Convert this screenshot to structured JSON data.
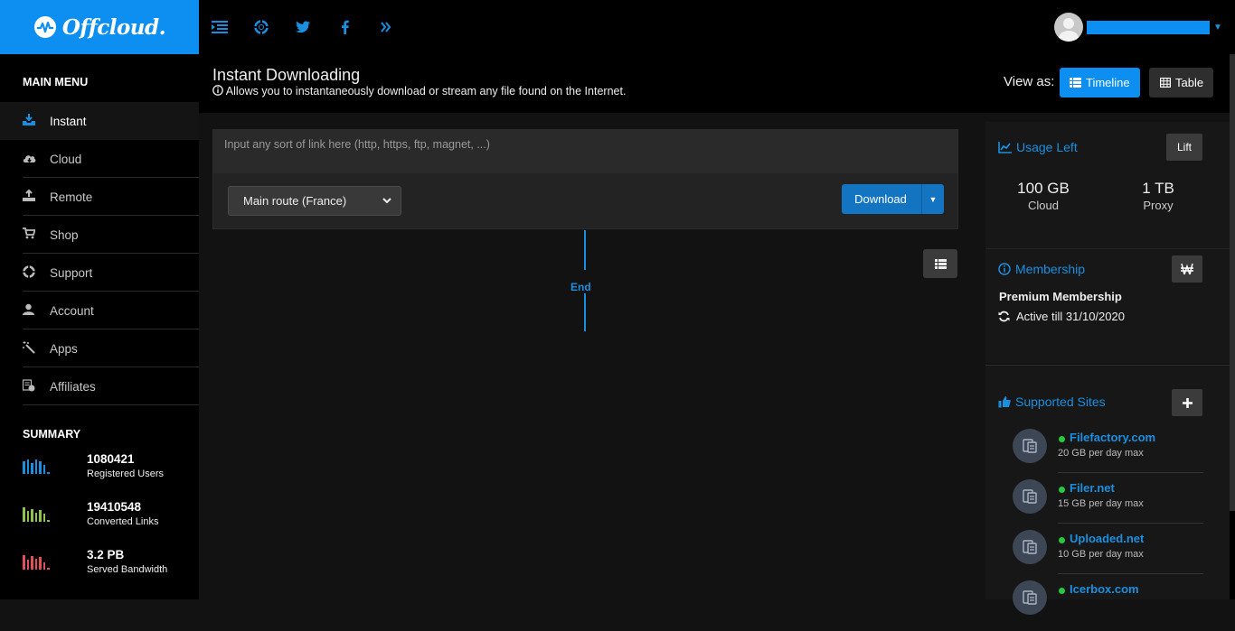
{
  "app": {
    "brand": "Offcloud."
  },
  "topbar": {
    "icons": [
      "menu-collapse-icon",
      "support-icon",
      "twitter-icon",
      "facebook-icon",
      "chevron-double-right-icon"
    ],
    "user": {
      "name": " "
    }
  },
  "sidebar": {
    "main_menu_heading": "MAIN MENU",
    "items": [
      {
        "label": "Instant",
        "icon": "download-tray-icon",
        "active": true
      },
      {
        "label": "Cloud",
        "icon": "cloud-download-icon"
      },
      {
        "label": "Remote",
        "icon": "upload-icon"
      },
      {
        "label": "Shop",
        "icon": "cart-icon"
      },
      {
        "label": "Support",
        "icon": "life-ring-icon"
      },
      {
        "label": "Account",
        "icon": "user-icon"
      },
      {
        "label": "Apps",
        "icon": "magic-wand-icon"
      },
      {
        "label": "Affiliates",
        "icon": "money-icon"
      }
    ],
    "summary_heading": "SUMMARY",
    "summary": [
      {
        "value": "1080421",
        "label": "Registered Users",
        "color": "#1a8fe0"
      },
      {
        "value": "19410548",
        "label": "Converted Links",
        "color": "#8fc24b"
      },
      {
        "value": "3.2 PB",
        "label": "Served Bandwidth",
        "color": "#e0505a"
      }
    ]
  },
  "header": {
    "title": "Instant Downloading",
    "subtitle": "Allows you to instantaneously download or stream any file found on the Internet.",
    "view_as": "View as:",
    "timeline_label": "Timeline",
    "table_label": "Table"
  },
  "form": {
    "link_placeholder": "Input any sort of link here (http, https, ftp, magnet, ...)",
    "route_selected": "Main route (France)",
    "download_label": "Download"
  },
  "timeline": {
    "end_label": "End"
  },
  "usage": {
    "title": "Usage Left",
    "lift_label": "Lift",
    "cloud_value": "100 GB",
    "cloud_label": "Cloud",
    "proxy_value": "1 TB",
    "proxy_label": "Proxy"
  },
  "membership": {
    "title": "Membership",
    "plan": "Premium Membership",
    "active_till": "Active till 31/10/2020"
  },
  "supported": {
    "title": "Supported Sites",
    "sites": [
      {
        "name": "Filefactory.com",
        "quota": "20 GB per day max"
      },
      {
        "name": "Filer.net",
        "quota": "15 GB per day max"
      },
      {
        "name": "Uploaded.net",
        "quota": "10 GB per day max"
      },
      {
        "name": "Icerbox.com",
        "quota": ""
      }
    ]
  },
  "colors": {
    "accent": "#0d8ff2",
    "online": "#27c93f"
  }
}
